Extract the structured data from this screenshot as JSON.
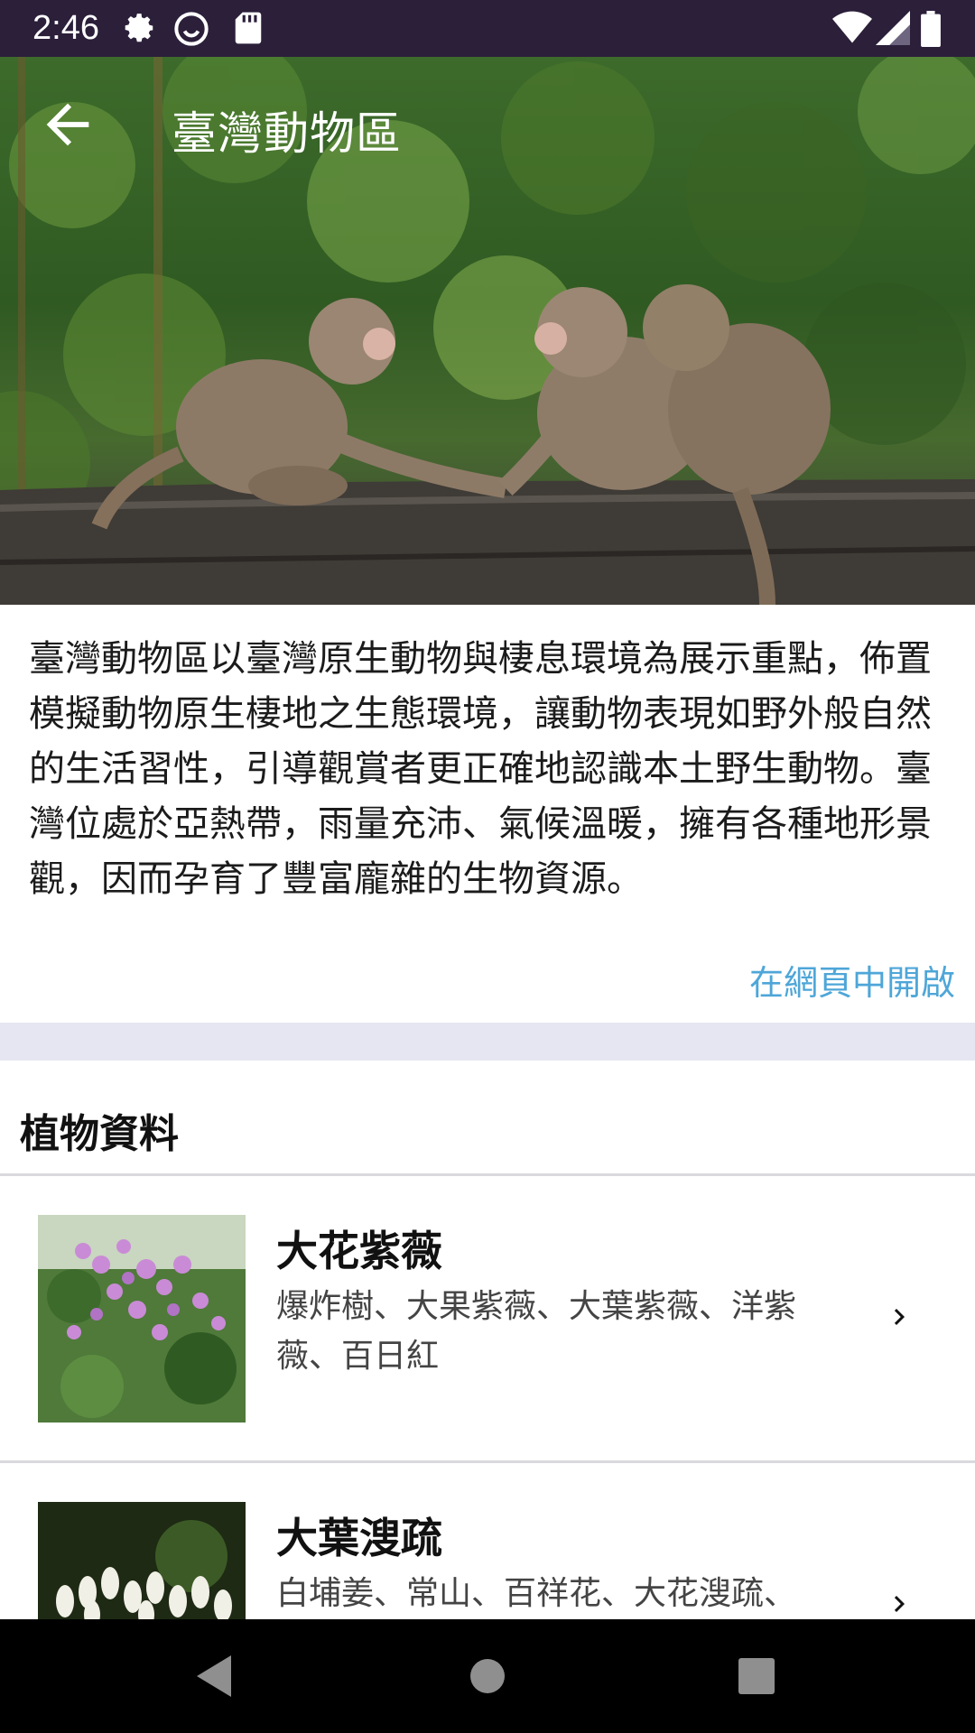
{
  "status_bar": {
    "time": "2:46",
    "icons": [
      "gear-icon",
      "smiley-icon",
      "sd-card-icon",
      "wifi-icon",
      "signal-icon",
      "battery-icon"
    ]
  },
  "header": {
    "title": "臺灣動物區",
    "back_icon": "arrow-left-icon"
  },
  "description": "臺灣動物區以臺灣原生動物與棲息環境為展示重點，佈置模擬動物原生棲地之生態環境，讓動物表現如野外般自然的生活習性，引導觀賞者更正確地認識本土野生動物。臺灣位處於亞熱帶，雨量充沛、氣候溫暖，擁有各種地形景觀，因而孕育了豐富龐雜的生物資源。",
  "open_web_label": "在網頁中開啟",
  "colors": {
    "link": "#4ea6d8",
    "status_bar": "#2b1f3a",
    "section_gap": "#e6e6f2"
  },
  "plants_section": {
    "title": "植物資料",
    "items": [
      {
        "name": "大花紫薇",
        "aliases": "爆炸樹、大果紫薇、大葉紫薇、洋紫薇、百日紅"
      },
      {
        "name": "大葉溲疏",
        "aliases": "白埔姜、常山、百祥花、大花溲疏、"
      }
    ]
  },
  "nav_bar": {
    "icons": [
      "back-triangle-icon",
      "home-circle-icon",
      "recents-square-icon"
    ]
  }
}
